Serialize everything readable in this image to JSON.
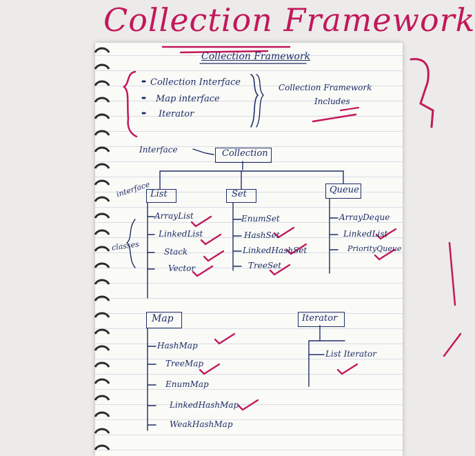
{
  "title": "Collection Framework",
  "page_heading": "Collection Framework",
  "intro": {
    "items": [
      "Collection Interface",
      "Map interface",
      "Iterator"
    ],
    "brace_label_line1": "Collection Framework",
    "brace_label_line2": "Includes"
  },
  "labels": {
    "interface_pointer": "Interface",
    "interface_side": "interface",
    "classes_side": "classes"
  },
  "tree": {
    "root": "Collection",
    "list": {
      "name": "List",
      "children": [
        "ArrayList",
        "LinkedList",
        "Stack",
        "Vector"
      ]
    },
    "set": {
      "name": "Set",
      "children": [
        "EnumSet",
        "HashSet",
        "LinkedHashSet",
        "TreeSet"
      ]
    },
    "queue": {
      "name": "Queue",
      "children": [
        "ArrayDeque",
        "LinkedList",
        "PriorityQueue"
      ]
    },
    "map": {
      "name": "Map",
      "children": [
        "HashMap",
        "TreeMap",
        "EnumMap",
        "LinkedHashMap",
        "WeakHashMap"
      ]
    },
    "iterator": {
      "name": "Iterator",
      "children": [
        "List Iterator"
      ]
    }
  },
  "colors": {
    "ink": "#1d2d66",
    "marker": "#c2185b",
    "paper": "#fafaf7",
    "background": "#ecebe9"
  }
}
